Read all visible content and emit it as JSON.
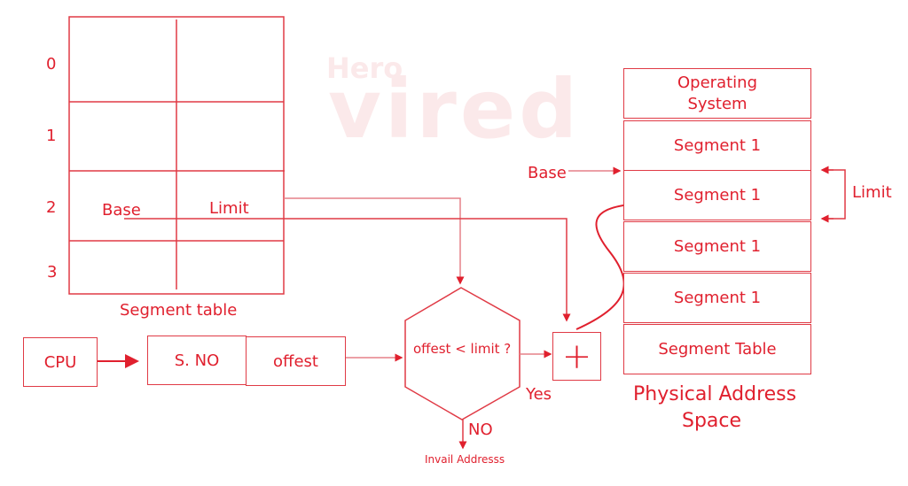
{
  "watermark": {
    "line1": "Hero",
    "line2": "vired"
  },
  "segment_table": {
    "row_labels": [
      "0",
      "1",
      "2",
      "3"
    ],
    "base_label": "Base",
    "limit_label": "Limit",
    "caption": "Segment table"
  },
  "cpu": {
    "cpu_label": "CPU",
    "segment_number_label": "S. NO",
    "offset_label": "offest"
  },
  "decision": {
    "condition": "offest < limit ?",
    "yes_label": "Yes",
    "no_label": "NO",
    "invalid_label": "Invail Addresss"
  },
  "adder": {
    "symbol": "+"
  },
  "physical_memory": {
    "blocks": [
      {
        "line1": "Operating",
        "line2": "System"
      },
      {
        "line1": "Segment 1"
      },
      {
        "line1": "Segment 1"
      },
      {
        "line1": "Segment 1"
      },
      {
        "line1": "Segment 1"
      },
      {
        "line1": "Segment  Table"
      }
    ],
    "base_label": "Base",
    "limit_label": "Limit",
    "caption_line1": "Physical Address",
    "caption_line2": "Space"
  },
  "colors": {
    "accent": "#e0202e",
    "watermark": "#fbe9ea"
  }
}
